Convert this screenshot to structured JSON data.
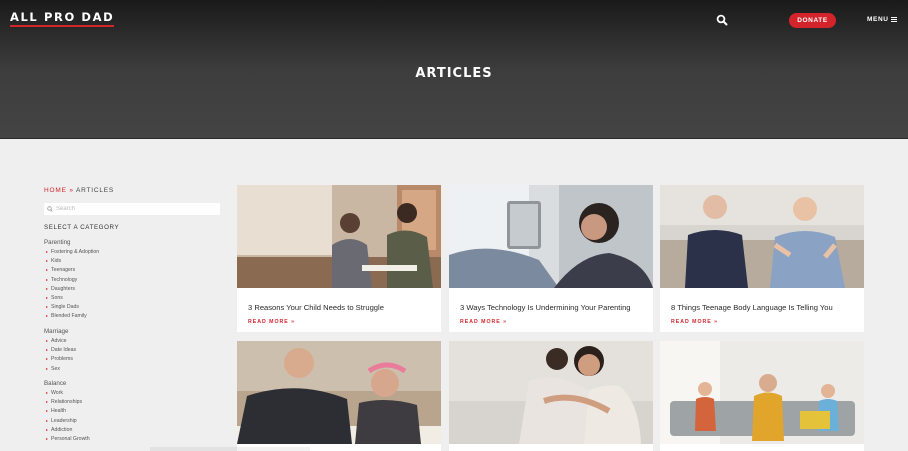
{
  "header": {
    "logo": "ALL PRO DAD",
    "donate_label": "DONATE",
    "menu_label": "MENU",
    "page_title": "ARTICLES"
  },
  "breadcrumb": {
    "home": "HOME",
    "separator": "»",
    "current": "ARTICLES"
  },
  "search": {
    "placeholder": "Search"
  },
  "sidebar": {
    "select_label": "SELECT A CATEGORY",
    "groups": [
      {
        "title": "Parenting",
        "items": [
          "Fostering & Adoption",
          "Kids",
          "Teenagers",
          "Technology",
          "Daughters",
          "Sons",
          "Single Dads",
          "Blended Family"
        ]
      },
      {
        "title": "Marriage",
        "items": [
          "Advice",
          "Date Ideas",
          "Problems",
          "Sex"
        ]
      },
      {
        "title": "Balance",
        "items": [
          "Work",
          "Relationships",
          "Health",
          "Leadership",
          "Addiction",
          "Personal Growth"
        ]
      }
    ]
  },
  "articles": [
    {
      "title": "3 Reasons Your Child Needs to Struggle",
      "read_more": "READ MORE »"
    },
    {
      "title": "3 Ways Technology Is Undermining Your Parenting",
      "read_more": "READ MORE »"
    },
    {
      "title": "8 Things Teenage Body Language Is Telling You",
      "read_more": "READ MORE »"
    },
    {
      "title": "",
      "read_more": ""
    },
    {
      "title": "",
      "read_more": ""
    },
    {
      "title": "",
      "read_more": ""
    }
  ],
  "colors": {
    "accent": "#d3242c",
    "hero_bg": "#3d3d3d",
    "page_bg": "#efefef"
  },
  "icons": {
    "search": "search-icon",
    "menu": "hamburger-icon",
    "bullet": "caret-right-icon"
  }
}
